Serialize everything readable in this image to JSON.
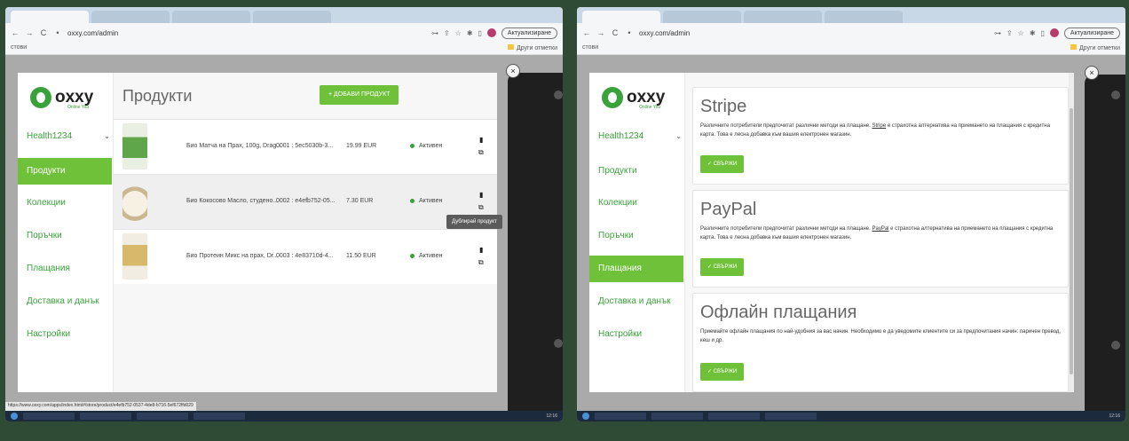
{
  "browser": {
    "url": "oxxy.com/admin",
    "update_label": "Актуализиране",
    "bookmarks_label": "стови",
    "bookmarks_right": "Други отметки",
    "close_symbol": "×"
  },
  "sidebar": {
    "logo_text": "oxxy",
    "logo_sub": "Online You",
    "store_name": "Health1234",
    "items": [
      {
        "label": "Продукти"
      },
      {
        "label": "Колекции"
      },
      {
        "label": "Поръчки"
      },
      {
        "label": "Плащания"
      },
      {
        "label": "Доставка и данък"
      },
      {
        "label": "Настройки"
      }
    ]
  },
  "products_page": {
    "title": "Продукти",
    "add_button": "+ ДОБАВИ ПРОДУКТ",
    "rows": [
      {
        "name": "Био Матча на Прах, 100g, Drag...",
        "sku": "0001 : 5ec5030b-3...",
        "price": "19.99 EUR",
        "status": "Активен"
      },
      {
        "name": "Био Кокосово Масло, студено...",
        "sku": "0002 : e4efb752-05...",
        "price": "7.30 EUR",
        "status": "Активен"
      },
      {
        "name": "Био Протеин Микс на прах, Dr...",
        "sku": "0003 : 4e83710d-4...",
        "price": "11.50 EUR",
        "status": "Активен"
      }
    ],
    "tooltip": "Дублирай продукт",
    "status_url": "https://www.oxxy.com/apps/index.html#/store/product/e4efb752-0537-4de8-b716-5ef672ffd029"
  },
  "payments_page": {
    "methods": [
      {
        "title": "Stripe",
        "desc_before": "Различните потребители предпочитат различни методи на плащане. ",
        "link": "Stripe",
        "desc_after": " е страхотна алтернатива на приемането на плащания с кредитна карта. Това е лесна добавка към вашия електронен магазин.",
        "button": "✓ СВЪРЖИ"
      },
      {
        "title": "PayPal",
        "desc_before": "Различните потребители предпочитат различни методи на плащане. ",
        "link": "PayPal",
        "desc_after": " е страхотна алтернатива на приемането на плащания с кредитна карта. Това е лесна добавка към вашия електронен магазин.",
        "button": "✓ СВЪРЖИ"
      },
      {
        "title": "Офлайн плащания",
        "desc_before": "Приемайте офлайн плащания по най-удобния за вас начин. Необходимо е да уведомите клиентите си за предпочитания начин: паричен превод, кеш и др.",
        "link": "",
        "desc_after": "",
        "button": "✓ СВЪРЖИ"
      }
    ]
  },
  "taskbar": {
    "clock_left": "12:16",
    "clock_right": "12:16"
  },
  "colors": {
    "brand_green": "#6fc13a",
    "text_green": "#39a23a"
  }
}
